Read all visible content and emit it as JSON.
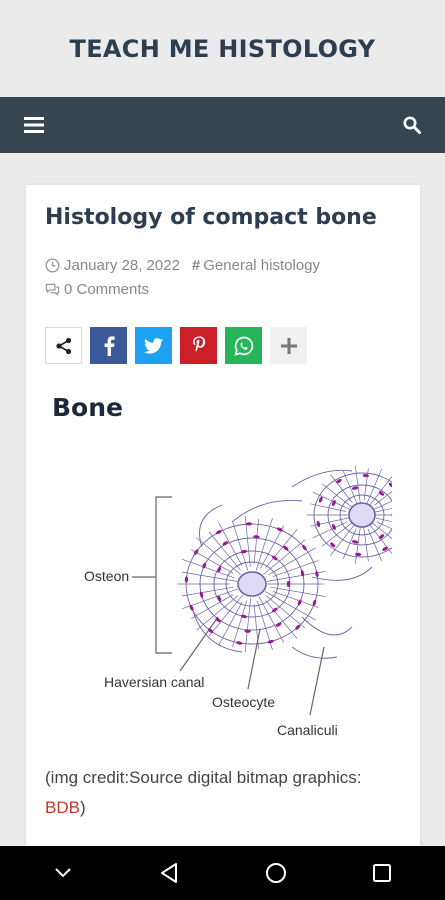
{
  "site": {
    "title": "TEACH ME HISTOLOGY"
  },
  "navbar": {
    "menu_icon": "hamburger-menu-icon",
    "search_icon": "search-icon",
    "background": "#36454f"
  },
  "post": {
    "title": "Histology of compact bone",
    "date": "January 28, 2022",
    "category": "General histology",
    "comments": "0 Comments",
    "section_heading": "Bone",
    "credit_prefix": "(img credit:Source digital bitmap graphics: ",
    "credit_link": "BDB",
    "credit_suffix": ")"
  },
  "share": [
    {
      "name": "share",
      "color": "#ffffff"
    },
    {
      "name": "facebook",
      "color": "#3b5998"
    },
    {
      "name": "twitter",
      "color": "#1da1f2"
    },
    {
      "name": "pinterest",
      "color": "#cb2027"
    },
    {
      "name": "whatsapp",
      "color": "#27b55a"
    },
    {
      "name": "more",
      "color": "#f0f0f0"
    }
  ],
  "diagram": {
    "labels": {
      "osteon": "Osteon",
      "haversian": "Haversian canal",
      "osteocyte": "Osteocyte",
      "canaliculi": "Canaliculi"
    }
  },
  "system_nav": {
    "keys": [
      "chevron-down-icon",
      "back-icon",
      "home-icon",
      "recents-icon"
    ]
  }
}
